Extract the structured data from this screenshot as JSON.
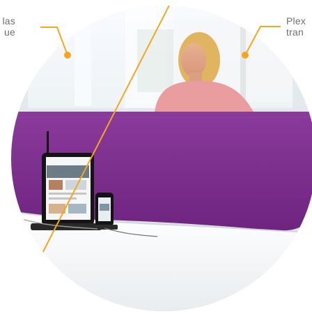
{
  "annotations": {
    "left": {
      "line1": "las",
      "line2": "ue"
    },
    "right": {
      "line1": "Plex",
      "line2": "tran"
    }
  },
  "colors": {
    "accent": "#f4a71d",
    "panel_purple": "#7a2d8c",
    "label_gray": "#6f6f6f"
  }
}
